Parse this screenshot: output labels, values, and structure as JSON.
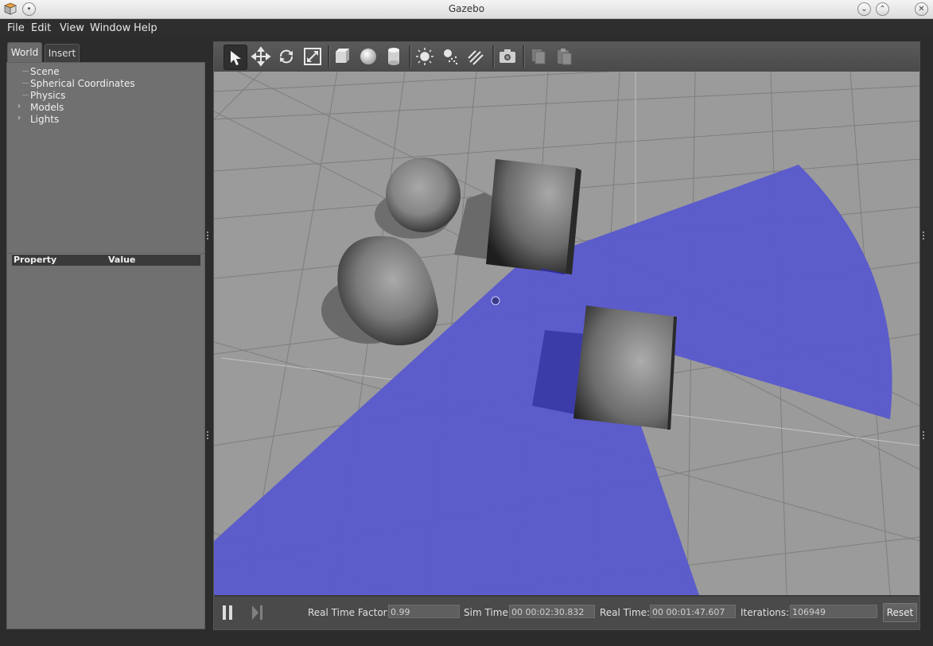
{
  "window": {
    "title": "Gazebo"
  },
  "menu": {
    "items": [
      {
        "label": "File"
      },
      {
        "label": "Edit"
      },
      {
        "label": "View"
      },
      {
        "label": "Window"
      },
      {
        "label": "Help"
      }
    ]
  },
  "left_panel": {
    "tabs": [
      {
        "label": "World",
        "active": true
      },
      {
        "label": "Insert",
        "active": false
      }
    ],
    "tree": [
      {
        "label": "Scene",
        "expandable": false
      },
      {
        "label": "Spherical Coordinates",
        "expandable": false
      },
      {
        "label": "Physics",
        "expandable": false
      },
      {
        "label": "Models",
        "expandable": true
      },
      {
        "label": "Lights",
        "expandable": true
      }
    ],
    "properties": {
      "col_property": "Property",
      "col_value": "Value"
    }
  },
  "toolbar": {
    "tools": [
      {
        "icon": "select-arrow-icon",
        "active": true
      },
      {
        "icon": "translate-icon"
      },
      {
        "icon": "rotate-icon"
      },
      {
        "icon": "scale-icon"
      },
      {
        "icon": "box-icon"
      },
      {
        "icon": "sphere-icon"
      },
      {
        "icon": "cylinder-icon"
      },
      {
        "icon": "point-light-icon"
      },
      {
        "icon": "spot-light-icon"
      },
      {
        "icon": "directional-light-icon"
      },
      {
        "icon": "screenshot-icon"
      },
      {
        "icon": "copy-icon"
      },
      {
        "icon": "paste-icon"
      }
    ]
  },
  "colors": {
    "ground": "#9a9a9a",
    "laser": "#5a5acc",
    "panel": "#707070",
    "toolbar": "#4e4e4e"
  },
  "status": {
    "real_time_factor_label": "Real Time Factor:",
    "real_time_factor": "0.99",
    "sim_time_label": "Sim Time:",
    "sim_time": "00 00:02:30.832",
    "real_time_label": "Real Time:",
    "real_time": "00 00:01:47.607",
    "iterations_label": "Iterations:",
    "iterations": "106949",
    "reset_label": "Reset"
  }
}
